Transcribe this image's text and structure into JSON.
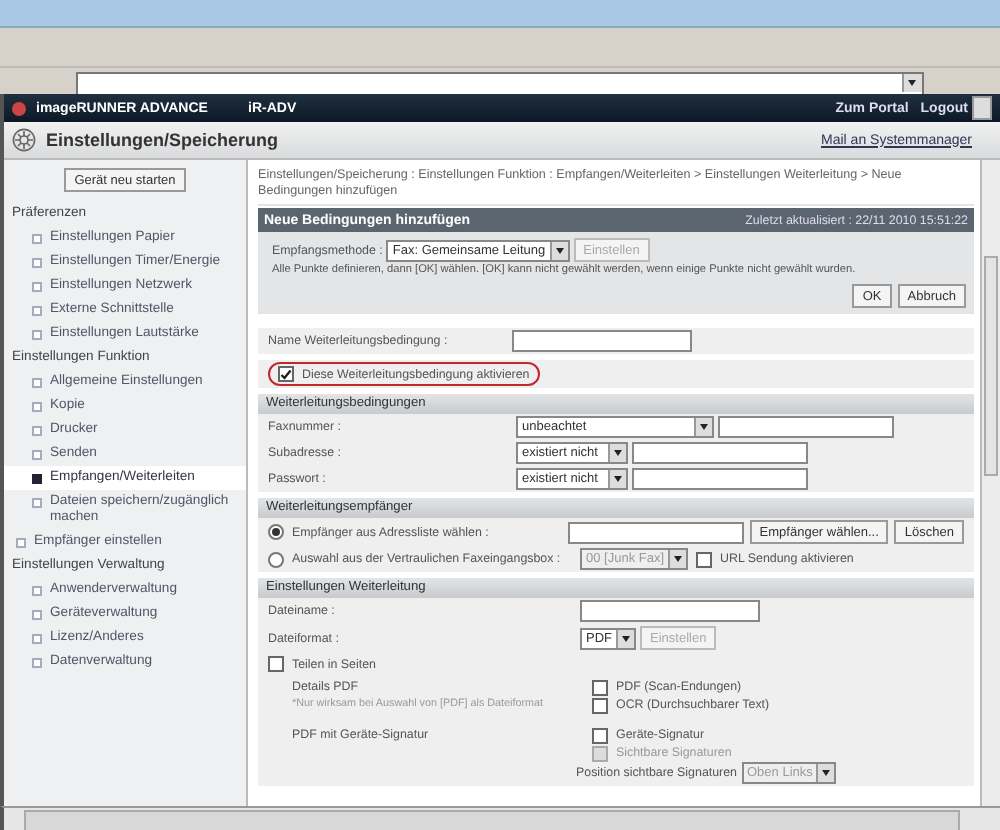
{
  "header": {
    "product": "imageRUNNER ADVANCE",
    "model": "iR-ADV",
    "links": [
      "Zum Portal",
      "Logout"
    ]
  },
  "title_bar": {
    "title": "Einstellungen/Speicherung",
    "link": "Mail an Systemmanager"
  },
  "sidebar": {
    "restart_button": "Gerät neu starten",
    "sections": [
      {
        "kind": "heading",
        "label": "Präferenzen",
        "children": [
          {
            "label": "Einstellungen Papier",
            "selected": false
          },
          {
            "label": "Einstellungen Timer/Energie",
            "selected": false
          },
          {
            "label": "Einstellungen Netzwerk",
            "selected": false
          },
          {
            "label": "Externe Schnittstelle",
            "selected": false
          },
          {
            "label": "Einstellungen Lautstärke",
            "selected": false
          }
        ]
      },
      {
        "kind": "heading",
        "label": "Einstellungen Funktion",
        "children": [
          {
            "label": "Allgemeine Einstellungen",
            "selected": false
          },
          {
            "label": "Kopie",
            "selected": false
          },
          {
            "label": "Drucker",
            "selected": false
          },
          {
            "label": "Senden",
            "selected": false
          },
          {
            "label": "Empfangen/Weiterleiten",
            "selected": true
          },
          {
            "label": "Dateien speichern/zugänglich machen",
            "selected": false
          }
        ]
      },
      {
        "kind": "item",
        "label": "Empfänger einstellen",
        "selected": false
      },
      {
        "kind": "heading",
        "label": "Einstellungen Verwaltung",
        "children": [
          {
            "label": "Anwenderverwaltung",
            "selected": false
          },
          {
            "label": "Geräteverwaltung",
            "selected": false
          },
          {
            "label": "Lizenz/Anderes",
            "selected": false
          },
          {
            "label": "Datenverwaltung",
            "selected": false
          }
        ]
      }
    ]
  },
  "main": {
    "breadcrumb": "Einstellungen/Speicherung : Einstellungen Funktion : Empfangen/Weiterleiten > Einstellungen Weiterleitung > Neue Bedingungen hinzufügen",
    "panel": {
      "title": "Neue Bedingungen hinzufügen",
      "updated": "Zuletzt aktualisiert : 22/11 2010 15:51:22",
      "method_label": "Empfangsmethode :",
      "method_value": "Fax: Gemeinsame Leitung",
      "method_button": {
        "label": "Einstellen",
        "disabled": true
      },
      "note": "Alle Punkte definieren, dann [OK] wählen. [OK] kann nicht gewählt werden, wenn einige Punkte nicht gewählt wurden.",
      "buttons": [
        "OK",
        "Abbruch"
      ]
    },
    "name_field": {
      "label": "Name Weiterleitungsbedingung :"
    },
    "enable_checkbox": {
      "label": "Diese Weiterleitungsbedingung aktivieren",
      "checked": true,
      "highlighted": true
    },
    "conditions": {
      "title": "Weiterleitungsbedingungen",
      "rows": [
        {
          "label": "Faxnummer :",
          "select": "unbeachtet"
        },
        {
          "label": "Subadresse :",
          "select": "existiert nicht"
        },
        {
          "label": "Passwort :",
          "select": "existiert nicht"
        }
      ]
    },
    "recipients": {
      "title": "Weiterleitungsempfänger",
      "options": [
        {
          "kind": "address",
          "label": "Empfänger aus Adressliste wählen :",
          "selected": true,
          "buttons": [
            "Empfänger wählen...",
            "Löschen"
          ]
        },
        {
          "kind": "box",
          "label": "Auswahl aus der Vertraulichen Faxeingangsbox :",
          "selected": false,
          "select": "00 [Junk Fax]",
          "select_disabled": true,
          "checkbox": {
            "label": "URL Sendung aktivieren",
            "checked": false
          }
        }
      ]
    },
    "forwarding": {
      "title": "Einstellungen Weiterleitung",
      "filename_label": "Dateiname :",
      "format_label": "Dateiformat :",
      "format_value": "PDF",
      "format_button": {
        "label": "Einstellen",
        "disabled": true
      },
      "split": {
        "label": "Teilen in Seiten",
        "checked": false
      },
      "groups": [
        {
          "label": "Details PDF",
          "note": "*Nur wirksam bei Auswahl von [PDF] als Dateiformat",
          "options": [
            {
              "label": "PDF (Scan-Endungen)",
              "checked": false,
              "disabled": false
            },
            {
              "label": "OCR (Durchsuchbarer Text)",
              "checked": false,
              "disabled": false
            }
          ]
        },
        {
          "label": "PDF mit Geräte-Signatur",
          "options": [
            {
              "label": "Geräte-Signatur",
              "checked": false,
              "disabled": false
            },
            {
              "label": "Sichtbare Signaturen",
              "checked": false,
              "disabled": true
            }
          ],
          "position": {
            "label": "Position sichtbare Signaturen",
            "value": "Oben Links",
            "disabled": true
          }
        }
      ]
    }
  }
}
